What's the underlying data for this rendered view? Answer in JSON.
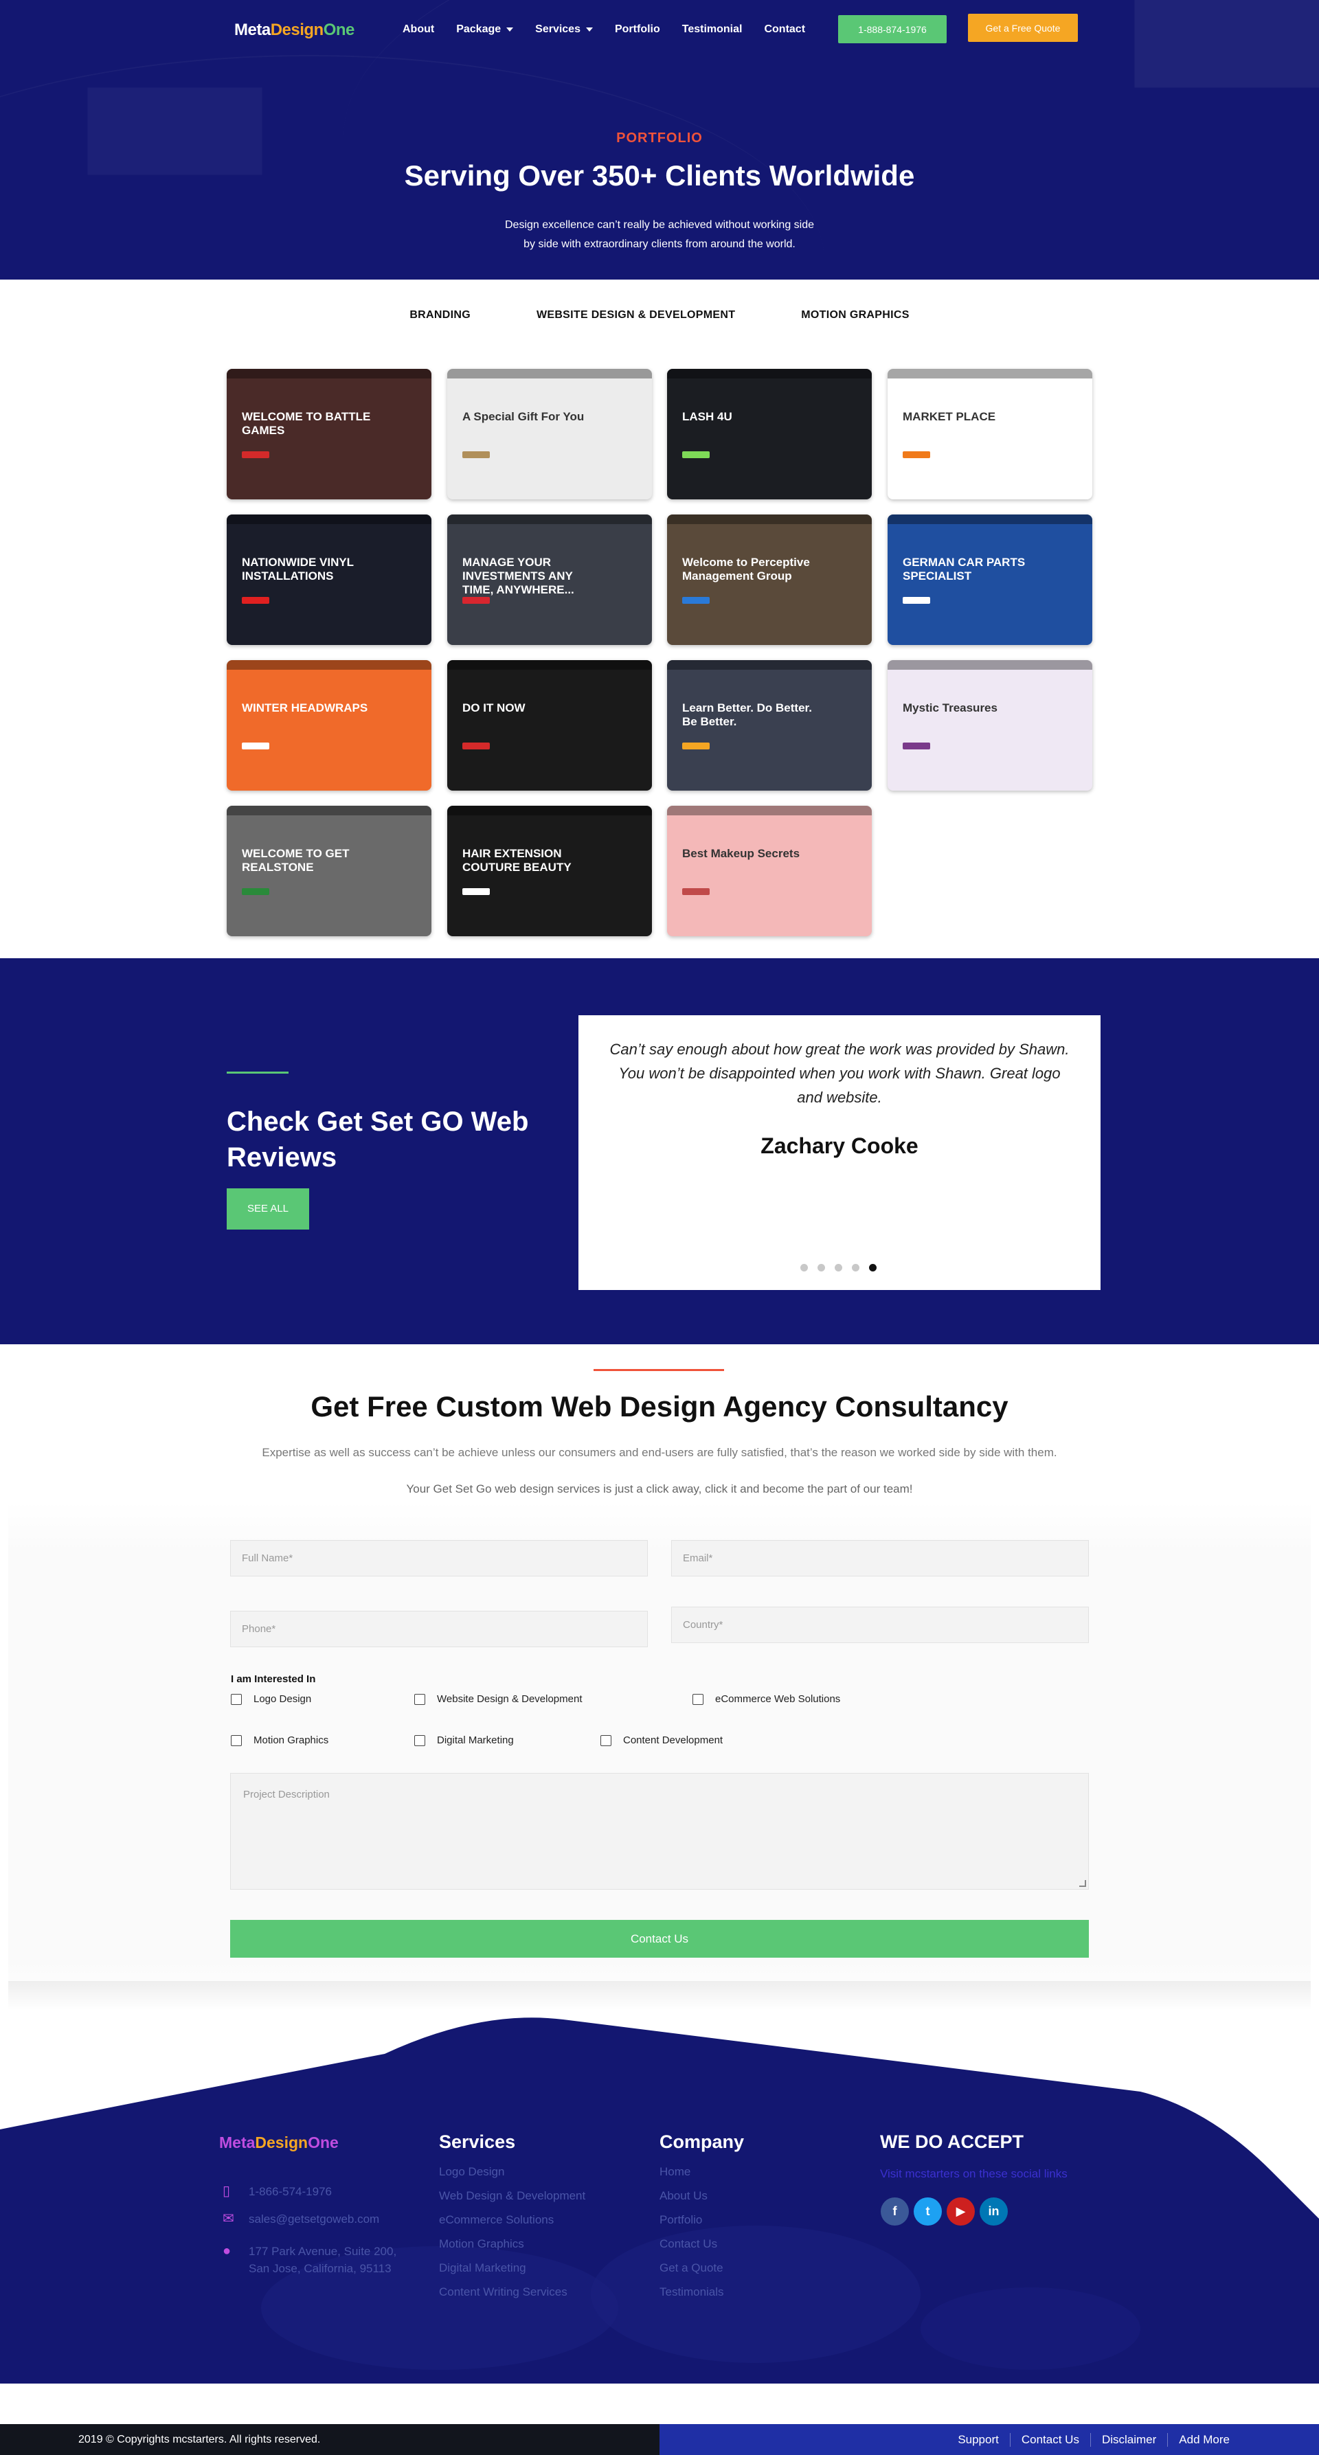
{
  "header": {
    "logo": {
      "part1": "Meta",
      "part2": "Design",
      "part3": "One"
    },
    "nav": [
      {
        "label": "About",
        "dropdown": false
      },
      {
        "label": "Package",
        "dropdown": true
      },
      {
        "label": "Services",
        "dropdown": true
      },
      {
        "label": "Portfolio",
        "dropdown": false
      },
      {
        "label": "Testimonial",
        "dropdown": false
      },
      {
        "label": "Contact",
        "dropdown": false
      }
    ],
    "phone_button": "1-888-874-1976",
    "quote_button": "Get a Free Quote"
  },
  "hero": {
    "kicker": "PORTFOLIO",
    "title": "Serving Over 350+ Clients Worldwide",
    "subtitle_line1": "Design excellence can’t really be achieved without working side",
    "subtitle_line2": "by side with extraordinary clients from around the world."
  },
  "tabs": [
    "BRANDING",
    "WEBSITE DESIGN & DEVELOPMENT",
    "MOTION GRAPHICS"
  ],
  "portfolio": [
    {
      "caption": "WELCOME TO BATTLE GAMES",
      "bg": "#4a2a28",
      "accent": "#d42a2a"
    },
    {
      "caption": "A Special Gift For You",
      "bg": "#ececec",
      "accent": "#b08f5a"
    },
    {
      "caption": "LASH 4U",
      "bg": "#1b1d22",
      "accent": "#7ed957"
    },
    {
      "caption": "MARKET PLACE",
      "bg": "#ffffff",
      "accent": "#f07a1a"
    },
    {
      "caption": "NATIONWIDE VINYL INSTALLATIONS",
      "bg": "#1a1d2a",
      "accent": "#e02020"
    },
    {
      "caption": "MANAGE YOUR INVESTMENTS ANY TIME, ANYWHERE...",
      "bg": "#3a3e48",
      "accent": "#d8262f"
    },
    {
      "caption": "Welcome to Perceptive Management Group",
      "bg": "#5a4a3a",
      "accent": "#2a7ad8"
    },
    {
      "caption": "GERMAN CAR PARTS SPECIALIST",
      "bg": "#1f4fa0",
      "accent": "#ffffff"
    },
    {
      "caption": "WINTER HEADWRAPS",
      "bg": "#f06a2a",
      "accent": "#ffffff"
    },
    {
      "caption": "DO IT NOW",
      "bg": "#1a1a1a",
      "accent": "#d42a2a"
    },
    {
      "caption": "Learn Better. Do Better. Be Better.",
      "bg": "#3a4050",
      "accent": "#f5a623"
    },
    {
      "caption": "Mystic Treasures",
      "bg": "#efe8f4",
      "accent": "#7a3a8a"
    },
    {
      "caption": "WELCOME TO GET REALSTONE",
      "bg": "#6a6a6a",
      "accent": "#2a8a3a"
    },
    {
      "caption": "HAIR EXTENSION COUTURE BEAUTY",
      "bg": "#1a1a1a",
      "accent": "#ffffff"
    },
    {
      "caption": "Best Makeup Secrets",
      "bg": "#f4b8b8",
      "accent": "#c04a4a"
    }
  ],
  "reviews": {
    "title": "Check Get Set GO Web Reviews",
    "see_all": "SEE ALL",
    "quote": "Can’t say enough about how great the work was provided by Shawn. You won’t be disappointed when you work with Shawn. Great logo and website.",
    "author": "Zachary Cooke",
    "dots": 5,
    "active_dot": 5
  },
  "consultancy": {
    "title": "Get Free Custom Web Design Agency Consultancy",
    "sub1": "Expertise as well as success can’t be achieve unless our consumers and end-users are fully satisfied, that’s the reason we worked side by side with them.",
    "sub2": "Your Get Set Go web design services is just a click away, click it and become the part of our team!",
    "form": {
      "full_name": "Full Name*",
      "email": "Email*",
      "phone": "Phone*",
      "country": "Country*",
      "interest_label": "I am Interested In",
      "interests": [
        "Logo Design",
        "Website Design & Development",
        "eCommerce Web Solutions",
        "Motion Graphics",
        "Digital Marketing",
        "Content Development"
      ],
      "description": "Project Description",
      "submit": "Contact Us"
    }
  },
  "footer": {
    "logo": {
      "part1": "Meta",
      "part2": "Design",
      "part3": "One"
    },
    "phone": "1-866-574-1976",
    "email": "sales@getsetgoweb.com",
    "address_line1": "177 Park Avenue, Suite 200,",
    "address_line2": "San Jose, California, 95113",
    "services_title": "Services",
    "services": [
      "Logo Design",
      "Web Design & Development",
      "eCommerce Solutions",
      "Motion Graphics",
      "Digital Marketing",
      "Content Writing Services"
    ],
    "company_title": "Company",
    "company": [
      "Home",
      "About Us",
      "Portfolio",
      "Contact Us",
      "Get a Quote",
      "Testimonials"
    ],
    "accept_title": "WE DO ACCEPT",
    "accept_note": "Visit mcstarters on these social links",
    "socials": [
      {
        "name": "facebook-icon",
        "glyph": "f",
        "color": "#3b5998"
      },
      {
        "name": "twitter-icon",
        "glyph": "t",
        "color": "#1da1f2"
      },
      {
        "name": "youtube-icon",
        "glyph": "▶",
        "color": "#cd201f"
      },
      {
        "name": "linkedin-icon",
        "glyph": "in",
        "color": "#0077b5"
      }
    ],
    "copyright": "2019 © Copyrights mcstarters. All rights reserved.",
    "bottom_links": [
      "Support",
      "Contact Us",
      "Disclaimer",
      "Add More"
    ]
  }
}
